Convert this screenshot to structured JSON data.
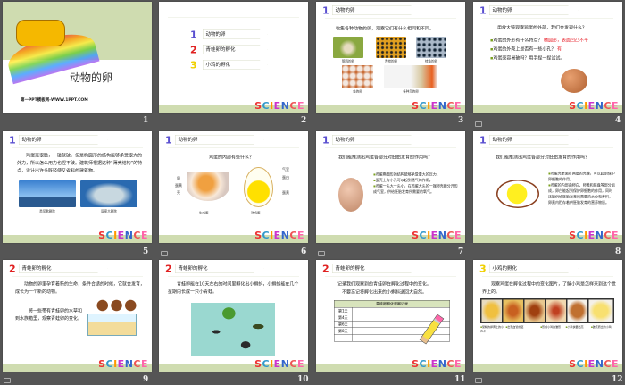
{
  "slides": [
    {
      "number": "1",
      "title": "动物的卵",
      "footer": "第一PPT模板网-WWW.1PPT.COM"
    },
    {
      "number": "2",
      "menu": [
        {
          "num": "1",
          "label": "动物的卵"
        },
        {
          "num": "2",
          "label": "青蛙卵的孵化"
        },
        {
          "num": "3",
          "label": "小鸡的孵化"
        }
      ],
      "logo": "SCIENCE"
    },
    {
      "number": "3",
      "header": "动物的卵",
      "text": "收集各种动物的卵，观察它们有什么相同和不同。",
      "captions": [
        "鹌鹑的卵",
        "青蛙的卵",
        "蛙鱼的卵",
        "鱼的卵",
        "各种鸟的卵"
      ]
    },
    {
      "number": "4",
      "header": "动物的卵",
      "text": "用放大镜观察鸡蛋的外部，我们会发现什么？",
      "q1": "鸡蛋的外形有什么特点？",
      "a1": "椭圆形，表面凹凸不平",
      "q2": "鸡蛋的外壳上是否有一些小孔？",
      "a2": "有",
      "q3": "鸡蛋壳容易破吗？用手捏一捏试试。"
    },
    {
      "number": "5",
      "header": "动物的卵",
      "text": "鸡蛋壳很脆，一碰就破。但是椭圆形的结构能够承受很大的外力，所以怎么用力也捏不破。建筑师根据这种“薄壳结构”的特点，设计出许多既轻便又省料的建筑物。",
      "captions": [
        "悉尼歌剧院",
        "国家大剧院"
      ]
    },
    {
      "number": "6",
      "header": "动物的卵",
      "text": "鸡蛋的内部有些什么？",
      "labels_left": [
        "卵",
        "蛋黄",
        "壳"
      ],
      "labels_right": [
        "气室",
        "蛋白",
        "蛋黄"
      ],
      "captions": [
        "生鸡蛋",
        "熟鸡蛋"
      ]
    },
    {
      "number": "7",
      "header": "动物的卵",
      "text": "我们能推测出鸡蛋各部分对胚胎发育的作用吗？",
      "bullets": [
        "鸡蛋椭圆形的结构能够承受更大的压力。",
        "蛋壳上有小孔可以起到透气的作用。",
        "鸡蛋一头大一头小，在鸡蛋大头的一端卵壳膜分开形成气室，供给胚胎发育所需要的氧气。"
      ]
    },
    {
      "number": "8",
      "header": "动物的卵",
      "text": "我们能推测出鸡蛋各部分对胚胎发育的作用吗？",
      "bullets": [
        "鸡蛋壳里面有两层的壳膜，可以起到保护卵细胞的作用。",
        "鸡蛋的内部由卵白、卵黄和胚盘等部分组成，卵白能起到保护卵细胞的作用，同时还能供给胚胎发育所需要的水分和养料，卵黄内贮存着供胚胎发育的营养物质。"
      ]
    },
    {
      "number": "9",
      "header": "青蛙卵的孵化",
      "text": "动物的卵里孕育着新的生命，条件合适的时候，它就会发育，成长为一个新的动物。",
      "text2": "将一些带有青蛙卵的水草和到水族箱里，观察青蛙卵的变化。"
    },
    {
      "number": "10",
      "header": "青蛙卵的孵化",
      "text": "青蛙卵能在10天左右的时间里孵化出小蝌蚪，小蝌蚪能在几个星期内长成一只小青蛙。"
    },
    {
      "number": "11",
      "header": "青蛙卵的孵化",
      "text": "记录我们观察到的青蛙卵在孵化过程中的变化。",
      "text2": "不要忘记将孵化出来的小蝌蚪送回大自然。",
      "table_title": "青蛙卵孵化观察记录",
      "rows": [
        "第1天",
        "第4天",
        "第6天",
        "第8天",
        "……"
      ]
    },
    {
      "number": "12",
      "header": "小鸡的孵化",
      "text": "观察鸡蛋在孵化过程中的变化图片，了解小鸡是怎样来到这个世界上的。",
      "notes": [
        "受精的卵黄上的小白点",
        "出现血管的胚",
        "形成小鸡的雏形",
        "小鸡快要出壳",
        "破壳而出的小鸡"
      ]
    }
  ],
  "colors": {
    "background": "#555555",
    "band": "#cfdcb0",
    "menu1": "#5a4fd0",
    "menu2": "#e02020",
    "menu3": "#f0d000"
  }
}
